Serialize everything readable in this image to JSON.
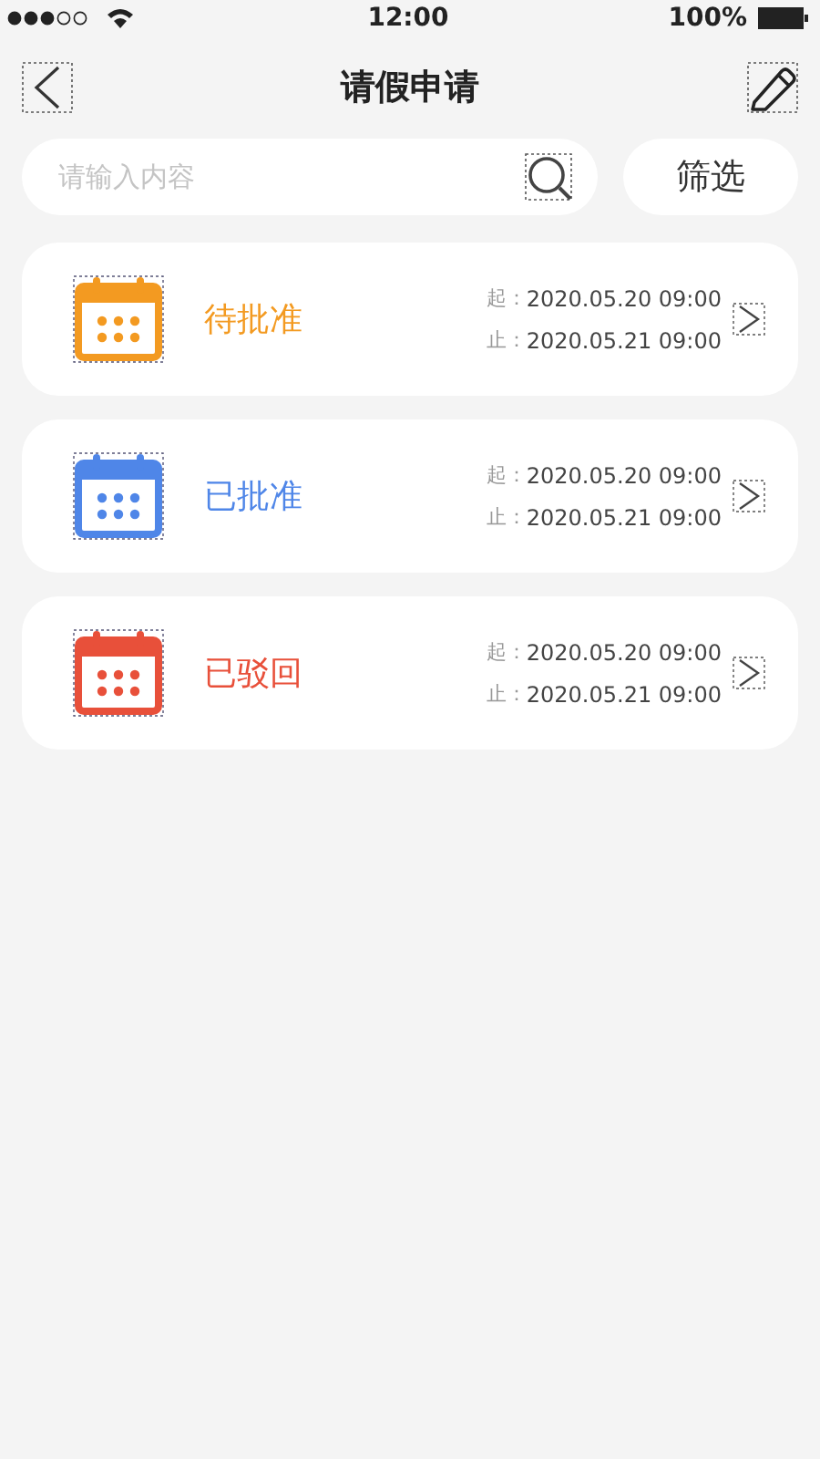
{
  "status_bar": {
    "time": "12:00",
    "battery": "100%"
  },
  "nav": {
    "title": "请假申请"
  },
  "search": {
    "placeholder": "请输入内容"
  },
  "filter_button": "筛选",
  "requests": [
    {
      "status": "待批准",
      "color": "#f39a21",
      "start_label": "起：",
      "start": "2020.05.20 09:00",
      "end_label": "止：",
      "end": "2020.05.21 09:00"
    },
    {
      "status": "已批准",
      "color": "#4f86e8",
      "start_label": "起：",
      "start": "2020.05.20 09:00",
      "end_label": "止：",
      "end": "2020.05.21 09:00"
    },
    {
      "status": "已驳回",
      "color": "#e8503a",
      "start_label": "起：",
      "start": "2020.05.20 09:00",
      "end_label": "止：",
      "end": "2020.05.21 09:00"
    }
  ]
}
